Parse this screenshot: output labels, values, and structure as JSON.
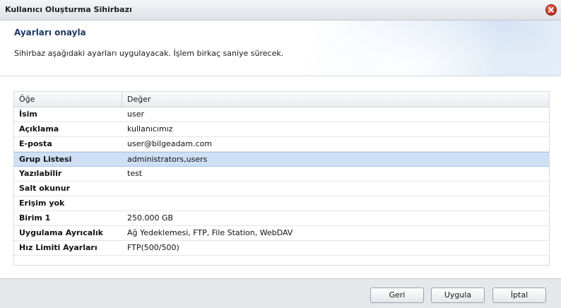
{
  "window": {
    "title": "Kullanıcı Oluşturma Sihirbazı",
    "close_icon": "close-icon"
  },
  "header": {
    "title": "Ayarları onayla",
    "description": "Sihirbaz aşağıdaki ayarları uygulayacak. İşlem birkaç saniye sürecek."
  },
  "table": {
    "columns": [
      "Öğe",
      "Değer"
    ],
    "rows": [
      {
        "key": "İsim",
        "value": "user",
        "selected": false
      },
      {
        "key": "Açıklama",
        "value": "kullanıcımız",
        "selected": false
      },
      {
        "key": "E-posta",
        "value": "user@bilgeadam.com",
        "selected": false
      },
      {
        "key": "Grup Listesi",
        "value": "administrators,users",
        "selected": true
      },
      {
        "key": "Yazılabilir",
        "value": "test",
        "selected": false
      },
      {
        "key": "Salt okunur",
        "value": "",
        "selected": false
      },
      {
        "key": "Erişim yok",
        "value": "",
        "selected": false
      },
      {
        "key": "Birim 1",
        "value": "250.000 GB",
        "selected": false
      },
      {
        "key": "Uygulama Ayrıcalık",
        "value": "Ağ Yedeklemesi, FTP, File Station, WebDAV",
        "selected": false
      },
      {
        "key": "Hız Limiti Ayarları",
        "value": "FTP(500/500)",
        "selected": false
      }
    ]
  },
  "footer": {
    "back_label": "Geri",
    "apply_label": "Uygula",
    "cancel_label": "İptal"
  },
  "colors": {
    "selected_row": "#cfe0f5",
    "header_title": "#1e3a66",
    "close_button": "#c0281a"
  }
}
